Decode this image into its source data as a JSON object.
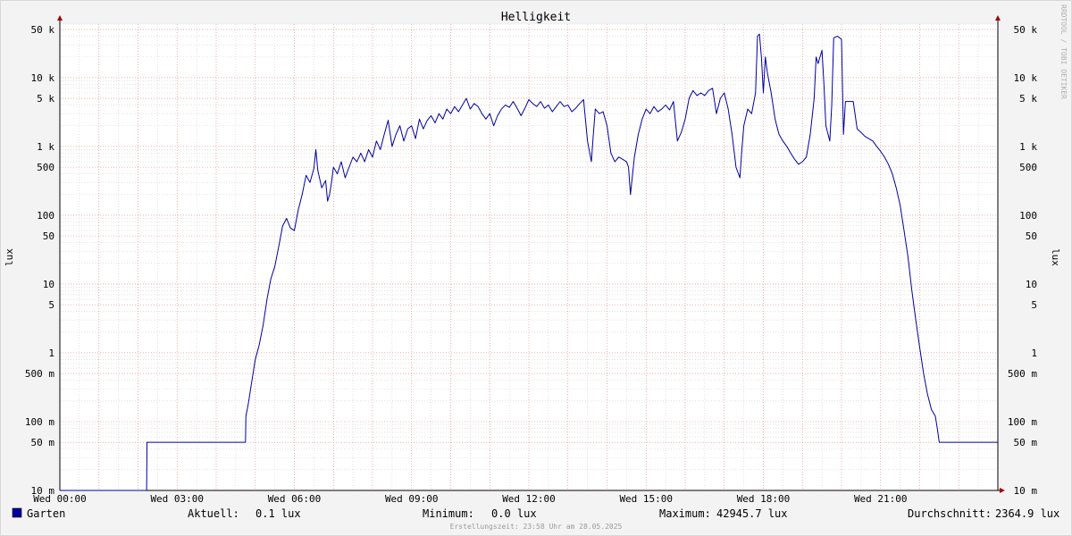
{
  "chart_data": {
    "type": "line",
    "title": "Helligkeit",
    "ylabel": "lux",
    "y_scale": "log",
    "ylim": [
      0.01,
      60000
    ],
    "xlim_hours": [
      0,
      24
    ],
    "x_ticks": [
      {
        "hour": 0,
        "label": "Wed 00:00"
      },
      {
        "hour": 3,
        "label": "Wed 03:00"
      },
      {
        "hour": 6,
        "label": "Wed 06:00"
      },
      {
        "hour": 9,
        "label": "Wed 09:00"
      },
      {
        "hour": 12,
        "label": "Wed 12:00"
      },
      {
        "hour": 15,
        "label": "Wed 15:00"
      },
      {
        "hour": 18,
        "label": "Wed 18:00"
      },
      {
        "hour": 21,
        "label": "Wed 21:00"
      }
    ],
    "y_ticks": [
      {
        "value": 0.01,
        "label": "10 m"
      },
      {
        "value": 0.05,
        "label": "50 m"
      },
      {
        "value": 0.1,
        "label": "100 m"
      },
      {
        "value": 0.5,
        "label": "500 m"
      },
      {
        "value": 1,
        "label": "1"
      },
      {
        "value": 5,
        "label": "5"
      },
      {
        "value": 10,
        "label": "10"
      },
      {
        "value": 50,
        "label": "50"
      },
      {
        "value": 100,
        "label": "100"
      },
      {
        "value": 500,
        "label": "500"
      },
      {
        "value": 1000,
        "label": "1 k"
      },
      {
        "value": 5000,
        "label": "5 k"
      },
      {
        "value": 10000,
        "label": "10 k"
      },
      {
        "value": 50000,
        "label": "50 k"
      }
    ],
    "series": [
      {
        "name": "Garten",
        "color": "#0000a0",
        "points": [
          [
            0,
            0.01
          ],
          [
            2.22,
            0.01
          ],
          [
            2.23,
            0.05
          ],
          [
            4.75,
            0.05
          ],
          [
            4.76,
            0.12
          ],
          [
            4.82,
            0.18
          ],
          [
            4.9,
            0.35
          ],
          [
            5.0,
            0.8
          ],
          [
            5.1,
            1.3
          ],
          [
            5.2,
            2.5
          ],
          [
            5.3,
            6
          ],
          [
            5.4,
            12
          ],
          [
            5.5,
            18
          ],
          [
            5.6,
            35
          ],
          [
            5.7,
            70
          ],
          [
            5.8,
            90
          ],
          [
            5.9,
            65
          ],
          [
            6.0,
            60
          ],
          [
            6.1,
            120
          ],
          [
            6.2,
            200
          ],
          [
            6.3,
            380
          ],
          [
            6.4,
            300
          ],
          [
            6.5,
            480
          ],
          [
            6.55,
            900
          ],
          [
            6.6,
            450
          ],
          [
            6.7,
            250
          ],
          [
            6.8,
            320
          ],
          [
            6.85,
            160
          ],
          [
            6.9,
            200
          ],
          [
            6.95,
            300
          ],
          [
            7.0,
            500
          ],
          [
            7.1,
            400
          ],
          [
            7.2,
            600
          ],
          [
            7.3,
            350
          ],
          [
            7.4,
            500
          ],
          [
            7.5,
            700
          ],
          [
            7.6,
            600
          ],
          [
            7.7,
            800
          ],
          [
            7.8,
            600
          ],
          [
            7.9,
            900
          ],
          [
            8.0,
            700
          ],
          [
            8.1,
            1200
          ],
          [
            8.2,
            900
          ],
          [
            8.3,
            1500
          ],
          [
            8.4,
            2400
          ],
          [
            8.5,
            1000
          ],
          [
            8.6,
            1500
          ],
          [
            8.7,
            2000
          ],
          [
            8.8,
            1200
          ],
          [
            8.9,
            1800
          ],
          [
            9.0,
            2000
          ],
          [
            9.1,
            1300
          ],
          [
            9.2,
            2500
          ],
          [
            9.3,
            1800
          ],
          [
            9.4,
            2400
          ],
          [
            9.5,
            2800
          ],
          [
            9.6,
            2200
          ],
          [
            9.7,
            3000
          ],
          [
            9.8,
            2500
          ],
          [
            9.9,
            3500
          ],
          [
            10.0,
            3000
          ],
          [
            10.1,
            3800
          ],
          [
            10.2,
            3200
          ],
          [
            10.3,
            4000
          ],
          [
            10.4,
            5000
          ],
          [
            10.5,
            3500
          ],
          [
            10.6,
            4200
          ],
          [
            10.7,
            3800
          ],
          [
            10.8,
            3000
          ],
          [
            10.9,
            2500
          ],
          [
            11.0,
            3000
          ],
          [
            11.1,
            2000
          ],
          [
            11.2,
            2800
          ],
          [
            11.3,
            3500
          ],
          [
            11.4,
            4000
          ],
          [
            11.5,
            3700
          ],
          [
            11.6,
            4500
          ],
          [
            11.7,
            3600
          ],
          [
            11.8,
            2800
          ],
          [
            11.9,
            3600
          ],
          [
            12.0,
            4800
          ],
          [
            12.1,
            4200
          ],
          [
            12.2,
            3800
          ],
          [
            12.3,
            4500
          ],
          [
            12.4,
            3600
          ],
          [
            12.5,
            4000
          ],
          [
            12.6,
            3200
          ],
          [
            12.7,
            3800
          ],
          [
            12.8,
            4500
          ],
          [
            12.9,
            3800
          ],
          [
            13.0,
            4000
          ],
          [
            13.1,
            3200
          ],
          [
            13.2,
            3600
          ],
          [
            13.3,
            4200
          ],
          [
            13.4,
            4800
          ],
          [
            13.5,
            1200
          ],
          [
            13.6,
            600
          ],
          [
            13.65,
            1500
          ],
          [
            13.7,
            3500
          ],
          [
            13.8,
            3000
          ],
          [
            13.9,
            3200
          ],
          [
            14.0,
            2000
          ],
          [
            14.1,
            800
          ],
          [
            14.2,
            600
          ],
          [
            14.3,
            700
          ],
          [
            14.4,
            650
          ],
          [
            14.5,
            600
          ],
          [
            14.55,
            500
          ],
          [
            14.6,
            200
          ],
          [
            14.7,
            700
          ],
          [
            14.8,
            1500
          ],
          [
            14.9,
            2500
          ],
          [
            15.0,
            3500
          ],
          [
            15.1,
            3000
          ],
          [
            15.2,
            3800
          ],
          [
            15.3,
            3200
          ],
          [
            15.4,
            3500
          ],
          [
            15.5,
            4000
          ],
          [
            15.6,
            3400
          ],
          [
            15.7,
            4500
          ],
          [
            15.8,
            1200
          ],
          [
            15.9,
            1600
          ],
          [
            16.0,
            2500
          ],
          [
            16.1,
            5000
          ],
          [
            16.2,
            6500
          ],
          [
            16.3,
            5500
          ],
          [
            16.4,
            6000
          ],
          [
            16.5,
            5500
          ],
          [
            16.6,
            6500
          ],
          [
            16.7,
            7000
          ],
          [
            16.8,
            3000
          ],
          [
            16.9,
            5000
          ],
          [
            17.0,
            6000
          ],
          [
            17.1,
            3500
          ],
          [
            17.2,
            1500
          ],
          [
            17.3,
            500
          ],
          [
            17.4,
            350
          ],
          [
            17.45,
            900
          ],
          [
            17.5,
            2000
          ],
          [
            17.6,
            3500
          ],
          [
            17.7,
            3000
          ],
          [
            17.8,
            6000
          ],
          [
            17.85,
            40000
          ],
          [
            17.9,
            43000
          ],
          [
            17.95,
            20000
          ],
          [
            18.0,
            6000
          ],
          [
            18.05,
            20000
          ],
          [
            18.1,
            12000
          ],
          [
            18.2,
            6000
          ],
          [
            18.3,
            2500
          ],
          [
            18.4,
            1500
          ],
          [
            18.5,
            1200
          ],
          [
            18.6,
            1000
          ],
          [
            18.7,
            800
          ],
          [
            18.8,
            650
          ],
          [
            18.9,
            550
          ],
          [
            19.0,
            600
          ],
          [
            19.1,
            700
          ],
          [
            19.2,
            1500
          ],
          [
            19.3,
            5000
          ],
          [
            19.35,
            20000
          ],
          [
            19.4,
            16000
          ],
          [
            19.5,
            25000
          ],
          [
            19.55,
            8000
          ],
          [
            19.6,
            2000
          ],
          [
            19.7,
            1200
          ],
          [
            19.75,
            4000
          ],
          [
            19.8,
            38000
          ],
          [
            19.9,
            40000
          ],
          [
            20.0,
            36000
          ],
          [
            20.05,
            1500
          ],
          [
            20.1,
            4500
          ],
          [
            20.2,
            4500
          ],
          [
            20.3,
            4500
          ],
          [
            20.4,
            1800
          ],
          [
            20.5,
            1600
          ],
          [
            20.6,
            1400
          ],
          [
            20.7,
            1300
          ],
          [
            20.8,
            1200
          ],
          [
            20.9,
            1000
          ],
          [
            21.0,
            850
          ],
          [
            21.1,
            700
          ],
          [
            21.2,
            550
          ],
          [
            21.3,
            400
          ],
          [
            21.4,
            250
          ],
          [
            21.5,
            140
          ],
          [
            21.6,
            60
          ],
          [
            21.7,
            25
          ],
          [
            21.8,
            8
          ],
          [
            21.9,
            3
          ],
          [
            22.0,
            1.2
          ],
          [
            22.1,
            0.5
          ],
          [
            22.2,
            0.25
          ],
          [
            22.3,
            0.15
          ],
          [
            22.4,
            0.12
          ],
          [
            22.45,
            0.08
          ],
          [
            22.5,
            0.05
          ],
          [
            24,
            0.05
          ]
        ]
      }
    ]
  },
  "legend": {
    "series_name": "Garten",
    "series_color": "#0000a0",
    "current_label": "Aktuell:",
    "current_value": "0.1 lux",
    "minimum_label": "Minimum:",
    "minimum_value": "0.0 lux",
    "maximum_label": "Maximum:",
    "maximum_value": "42945.7 lux",
    "average_label": "Durchschnitt:",
    "average_value": "2364.9 lux"
  },
  "footer": {
    "created": "Erstellungszeit: 23:58 Uhr am 28.05.2025"
  },
  "watermark": "RRDTOOL / TOBI OETIKER",
  "colors": {
    "background": "#f3f3f3",
    "canvas": "#ffffff",
    "grid_major": "#e08080",
    "grid_minor": "#d0d0d0",
    "line": "#0000a0",
    "arrow": "#a00000"
  }
}
